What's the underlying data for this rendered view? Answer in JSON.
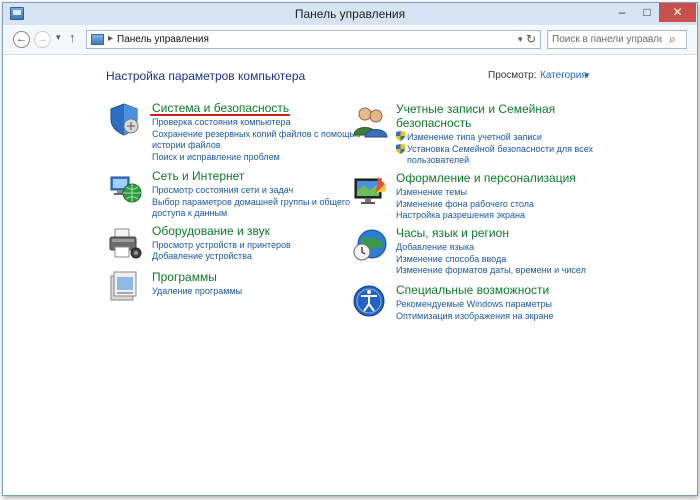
{
  "window": {
    "title": "Панель управления",
    "controls": {
      "minimize": "–",
      "maximize": "□",
      "close": "✕"
    }
  },
  "nav": {
    "back": "←",
    "forward": "→",
    "recent": "▾",
    "up": "↑",
    "address_sep": "▸",
    "address": "Панель управления",
    "address_dropdown": "▾",
    "refresh": "↻",
    "search_placeholder": "Поиск в панели управления",
    "search_icon": "⌕"
  },
  "page": {
    "title": "Настройка параметров компьютера",
    "view_by_label": "Просмотр:",
    "view_by_value": "Категория",
    "view_by_arrow": "▼"
  },
  "categories": [
    {
      "title": "Система и безопасность",
      "icon": "shield-icon",
      "links": [
        "Проверка состояния компьютера",
        "Сохранение резервных копий файлов с помощью",
        "истории файлов",
        "Поиск и исправление проблем"
      ]
    },
    {
      "title": "Сеть и Интернет",
      "icon": "network-globe-icon",
      "links": [
        "Просмотр состояния сети и задач",
        "Выбор параметров домашней группы и общего",
        "доступа к данным"
      ]
    },
    {
      "title": "Оборудование и звук",
      "icon": "printer-icon",
      "links": [
        "Просмотр устройств и принтеров",
        "Добавление устройства"
      ]
    },
    {
      "title": "Программы",
      "icon": "programs-icon",
      "links": [
        "Удаление программы"
      ]
    },
    {
      "title_line1": "Учетные записи и Семейная",
      "title_line2": "безопасность",
      "icon": "users-icon",
      "links": [
        "Изменение типа учетной записи",
        "Установка Семейной безопасности для всех",
        "пользователей"
      ]
    },
    {
      "title": "Оформление и персонализация",
      "icon": "appearance-icon",
      "links": [
        "Изменение темы",
        "Изменение фона рабочего стола",
        "Настройка разрешения экрана"
      ]
    },
    {
      "title": "Часы, язык и регион",
      "icon": "clock-globe-icon",
      "links": [
        "Добавление языка",
        "Изменение способа ввода",
        "Изменение форматов даты, времени и чисел"
      ]
    },
    {
      "title": "Специальные возможности",
      "icon": "accessibility-icon",
      "links": [
        "Рекомендуемые Windows параметры",
        "Оптимизация изображения на экране"
      ]
    }
  ],
  "colors": {
    "category_title": "#0e7a2a",
    "link": "#1e5aa8",
    "page_title": "#1e3287",
    "highlight_underline": "#d31c1c"
  }
}
